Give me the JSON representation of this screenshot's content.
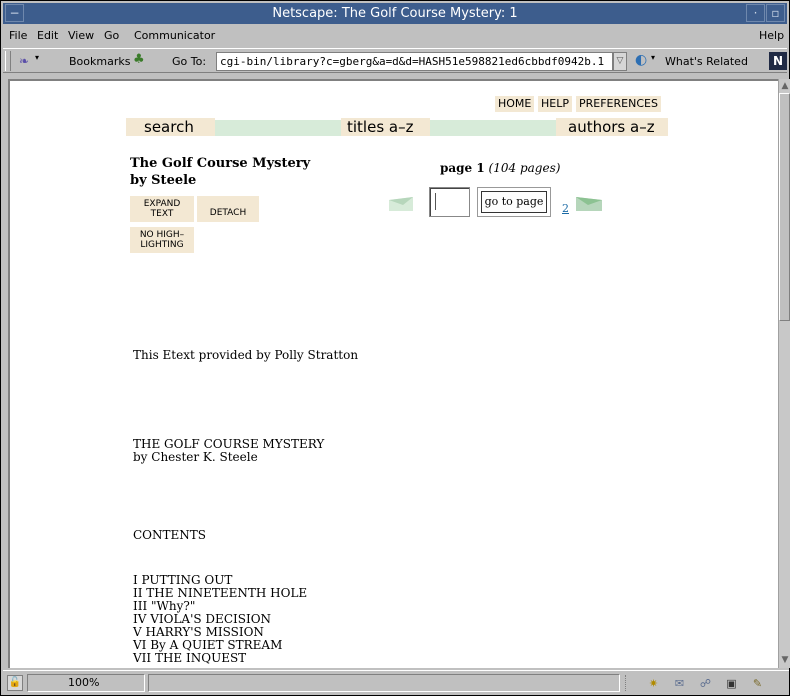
{
  "window": {
    "title": "Netscape: The Golf Course Mystery: 1"
  },
  "menu": {
    "file": "File",
    "edit": "Edit",
    "view": "View",
    "go": "Go",
    "communicator": "Communicator",
    "help": "Help"
  },
  "location": {
    "bookmarks_label": "Bookmarks",
    "goto_label": "Go To:",
    "url": "cgi-bin/library?c=gberg&a=d&d=HASH51e598821ed6cbbdf0942b.1",
    "whats_related": "What's Related"
  },
  "nav": {
    "home": "HOME",
    "help": "HELP",
    "preferences": "PREFERENCES",
    "search": "search",
    "titles": "titles a–z",
    "authors": "authors a–z"
  },
  "doc": {
    "title": "The Golf Course Mystery",
    "author": "by Steele",
    "expand_text": "EXPAND\nTEXT",
    "detach": "DETACH",
    "no_highlighting": "NO HIGH–\nLIGHTING",
    "page_label": "page 1",
    "pages_count": "(104 pages)",
    "page_input": "",
    "go_to_page": "go to page",
    "next_page_num": "2"
  },
  "body": {
    "provided_by": "This Etext provided by Polly Stratton",
    "book_title": "THE GOLF COURSE MYSTERY",
    "book_author": "by Chester K. Steele",
    "contents_heading": "CONTENTS",
    "chapters": [
      "I PUTTING OUT",
      "II THE NINETEENTH HOLE",
      "III \"Why?\"",
      "IV VIOLA'S DECISION",
      "V HARRY'S MISSION",
      "VI By A QUIET STREAM",
      "VII THE INQUEST"
    ]
  },
  "status": {
    "zoom": "100%"
  }
}
